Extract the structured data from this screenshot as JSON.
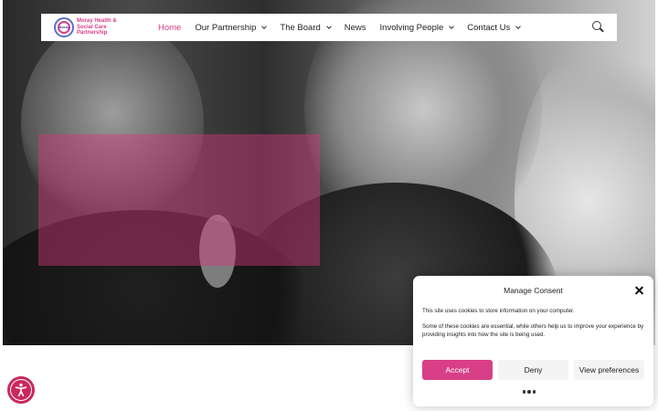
{
  "header": {
    "logo_text": "Moray Health & Social Care Partnership",
    "logo_mark_text": "Moray",
    "nav": [
      {
        "label": "Home",
        "active": true,
        "has_dropdown": false
      },
      {
        "label": "Our Partnership",
        "active": false,
        "has_dropdown": true
      },
      {
        "label": "The Board",
        "active": false,
        "has_dropdown": true
      },
      {
        "label": "News",
        "active": false,
        "has_dropdown": false
      },
      {
        "label": "Involving People",
        "active": false,
        "has_dropdown": true
      },
      {
        "label": "Contact Us",
        "active": false,
        "has_dropdown": true
      }
    ],
    "search_icon": "search-icon"
  },
  "hero": {
    "image": "grayscale photo of smiling women",
    "overlay_color": "#d7377d"
  },
  "consent": {
    "title": "Manage Consent",
    "text1": "This site uses cookies to store information on your computer.",
    "text2": "Some of these cookies are essential, while others help us to improve your experience by providing insights into how the site is being used.",
    "accept_label": "Accept",
    "deny_label": "Deny",
    "preferences_label": "View preferences",
    "close_icon": "close-icon",
    "more_icon": "more-dots-icon"
  },
  "accessibility": {
    "icon": "accessibility-icon",
    "color": "#c9285f"
  },
  "colors": {
    "accent": "#d83f87",
    "text": "#222222"
  }
}
